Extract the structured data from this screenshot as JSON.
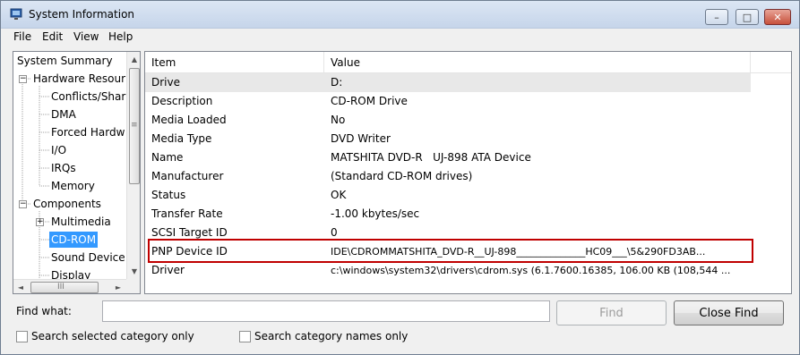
{
  "window": {
    "title": "System Information"
  },
  "caption_buttons": {
    "minimize": "–",
    "maximize": "□",
    "close": "✕"
  },
  "menu": {
    "items": [
      {
        "label": "File"
      },
      {
        "label": "Edit"
      },
      {
        "label": "View"
      },
      {
        "label": "Help"
      }
    ]
  },
  "tree": {
    "items": [
      {
        "label": "System Summary",
        "expander": ""
      },
      {
        "label": "Hardware Resour",
        "expander": "−"
      },
      {
        "label": "Conflicts/Shari",
        "expander": ""
      },
      {
        "label": "DMA",
        "expander": ""
      },
      {
        "label": "Forced Hardw",
        "expander": ""
      },
      {
        "label": "I/O",
        "expander": ""
      },
      {
        "label": "IRQs",
        "expander": ""
      },
      {
        "label": "Memory",
        "expander": ""
      },
      {
        "label": "Components",
        "expander": "−"
      },
      {
        "label": "Multimedia",
        "expander": "+"
      },
      {
        "label": "CD-ROM",
        "expander": "",
        "selected": true
      },
      {
        "label": "Sound Device",
        "expander": ""
      },
      {
        "label": "Display",
        "expander": ""
      }
    ],
    "scroll": {
      "up": "▲",
      "down": "▼",
      "left": "◄",
      "right": "►",
      "grip_v": "≡",
      "grip_h": "III"
    }
  },
  "table": {
    "columns": [
      {
        "label": "Item"
      },
      {
        "label": "Value"
      }
    ],
    "rows": [
      {
        "item": "Drive",
        "value": "D:"
      },
      {
        "item": "Description",
        "value": "CD-ROM Drive"
      },
      {
        "item": "Media Loaded",
        "value": "No"
      },
      {
        "item": "Media Type",
        "value": "DVD Writer"
      },
      {
        "item": "Name",
        "value": "MATSHITA DVD-R   UJ-898 ATA Device"
      },
      {
        "item": "Manufacturer",
        "value": "(Standard CD-ROM drives)"
      },
      {
        "item": "Status",
        "value": "OK"
      },
      {
        "item": "Transfer Rate",
        "value": "-1.00 kbytes/sec"
      },
      {
        "item": "SCSI Target ID",
        "value": "0"
      },
      {
        "item": "PNP Device ID",
        "value": "IDE\\CDROMMATSHITA_DVD-R__UJ-898______________HC09___\\5&290FD3AB..."
      },
      {
        "item": "Driver",
        "value": "c:\\windows\\system32\\drivers\\cdrom.sys (6.1.7600.16385, 106.00 KB (108,544 ..."
      }
    ]
  },
  "find": {
    "label": "Find what:",
    "value": "",
    "placeholder": "",
    "find_button": "Find",
    "close_find_button": "Close Find",
    "option_selected_category": "Search selected category only",
    "option_category_names": "Search category names only"
  },
  "colors": {
    "selection": "#3399ff",
    "highlight_border": "#c00000"
  }
}
